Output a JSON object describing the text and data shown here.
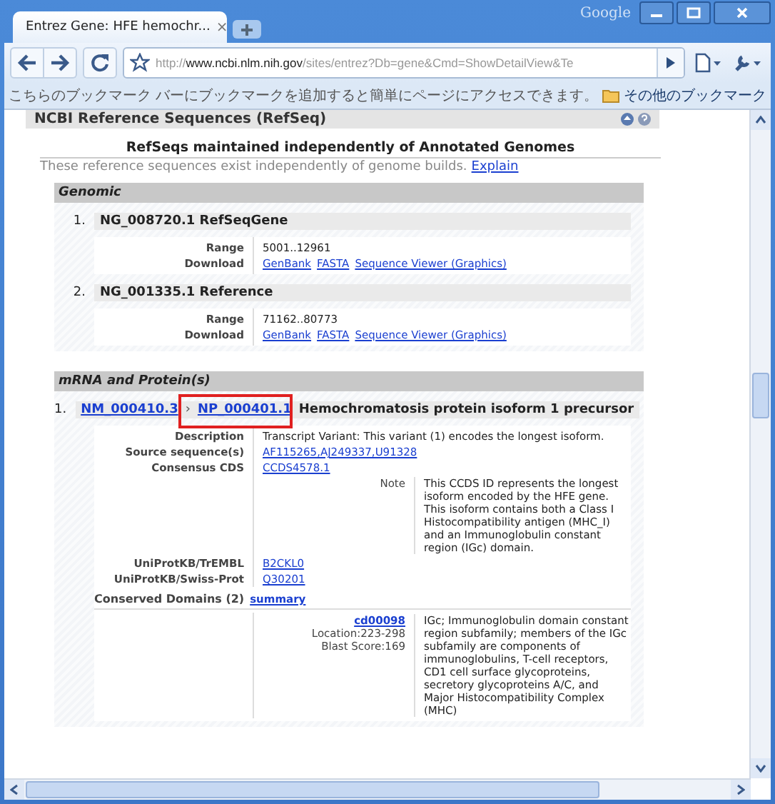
{
  "browser": {
    "brand": "Google",
    "tab": {
      "title": "Entrez Gene: HFE hemochr...",
      "close": "×"
    },
    "address": {
      "scheme": "http://",
      "host": "www.ncbi.nlm.nih.gov",
      "path": "/sites/entrez?Db=gene&Cmd=ShowDetailView&Te"
    },
    "bookmarks_bar": {
      "message": "こちらのブックマーク バーにブックマークを追加すると簡単にページにアクセスできます。",
      "other": "その他のブックマーク"
    }
  },
  "page": {
    "section_title": "NCBI Reference Sequences (RefSeq)",
    "heading": "RefSeqs maintained independently of Annotated Genomes",
    "intro": "These reference sequences exist independently of genome builds.",
    "intro_link": "Explain",
    "genomic": {
      "title": "Genomic",
      "items": [
        {
          "number": "1.",
          "title": "NG_008720.1 RefSeqGene",
          "range_label": "Range",
          "range": "5001..12961",
          "download_label": "Download",
          "links": [
            "GenBank",
            "FASTA",
            "Sequence Viewer (Graphics)"
          ]
        },
        {
          "number": "2.",
          "title": "NG_001335.1 Reference",
          "range_label": "Range",
          "range": "71162..80773",
          "download_label": "Download",
          "links": [
            "GenBank",
            "FASTA",
            "Sequence Viewer (Graphics)"
          ]
        }
      ]
    },
    "mrna": {
      "title": "mRNA and Protein(s)",
      "items": [
        {
          "number": "1.",
          "mrna": "NM_000410.3",
          "separator": "›",
          "protein": "NP_000401.1",
          "highlighted": true,
          "name": "Hemochromatosis protein isoform 1 precursor",
          "description": {
            "label": "Description",
            "value": "Transcript Variant: This variant (1) encodes the longest isoform."
          },
          "source": {
            "label": "Source sequence(s)",
            "value": "AF115265,AJ249337,U91328"
          },
          "ccds": {
            "label": "Consensus CDS",
            "value": "CCDS4578.1",
            "note_label": "Note",
            "note": "This CCDS ID represents the longest isoform encoded by the HFE gene. This isoform contains both a Class I Histocompatibility antigen (MHC_I) and an Immunoglobulin constant region (IGc) domain."
          },
          "uniprot": [
            {
              "label": "UniProtKB/TrEMBL",
              "value": "B2CKL0"
            },
            {
              "label": "UniProtKB/Swiss-Prot",
              "value": "Q30201"
            }
          ],
          "domains": {
            "label": "Conserved Domains (2)",
            "link": "summary",
            "items": [
              {
                "id": "cd00098",
                "location": "Location:223-298",
                "score": "Blast Score:169",
                "text": "IGc; Immunoglobulin domain constant region subfamily; members of the IGc subfamily are components of immunoglobulins, T-cell receptors, CD1 cell surface glycoproteins, secretory glycoproteins A/C, and Major Histocompatibility Complex (MHC)"
              }
            ]
          }
        }
      ]
    }
  }
}
